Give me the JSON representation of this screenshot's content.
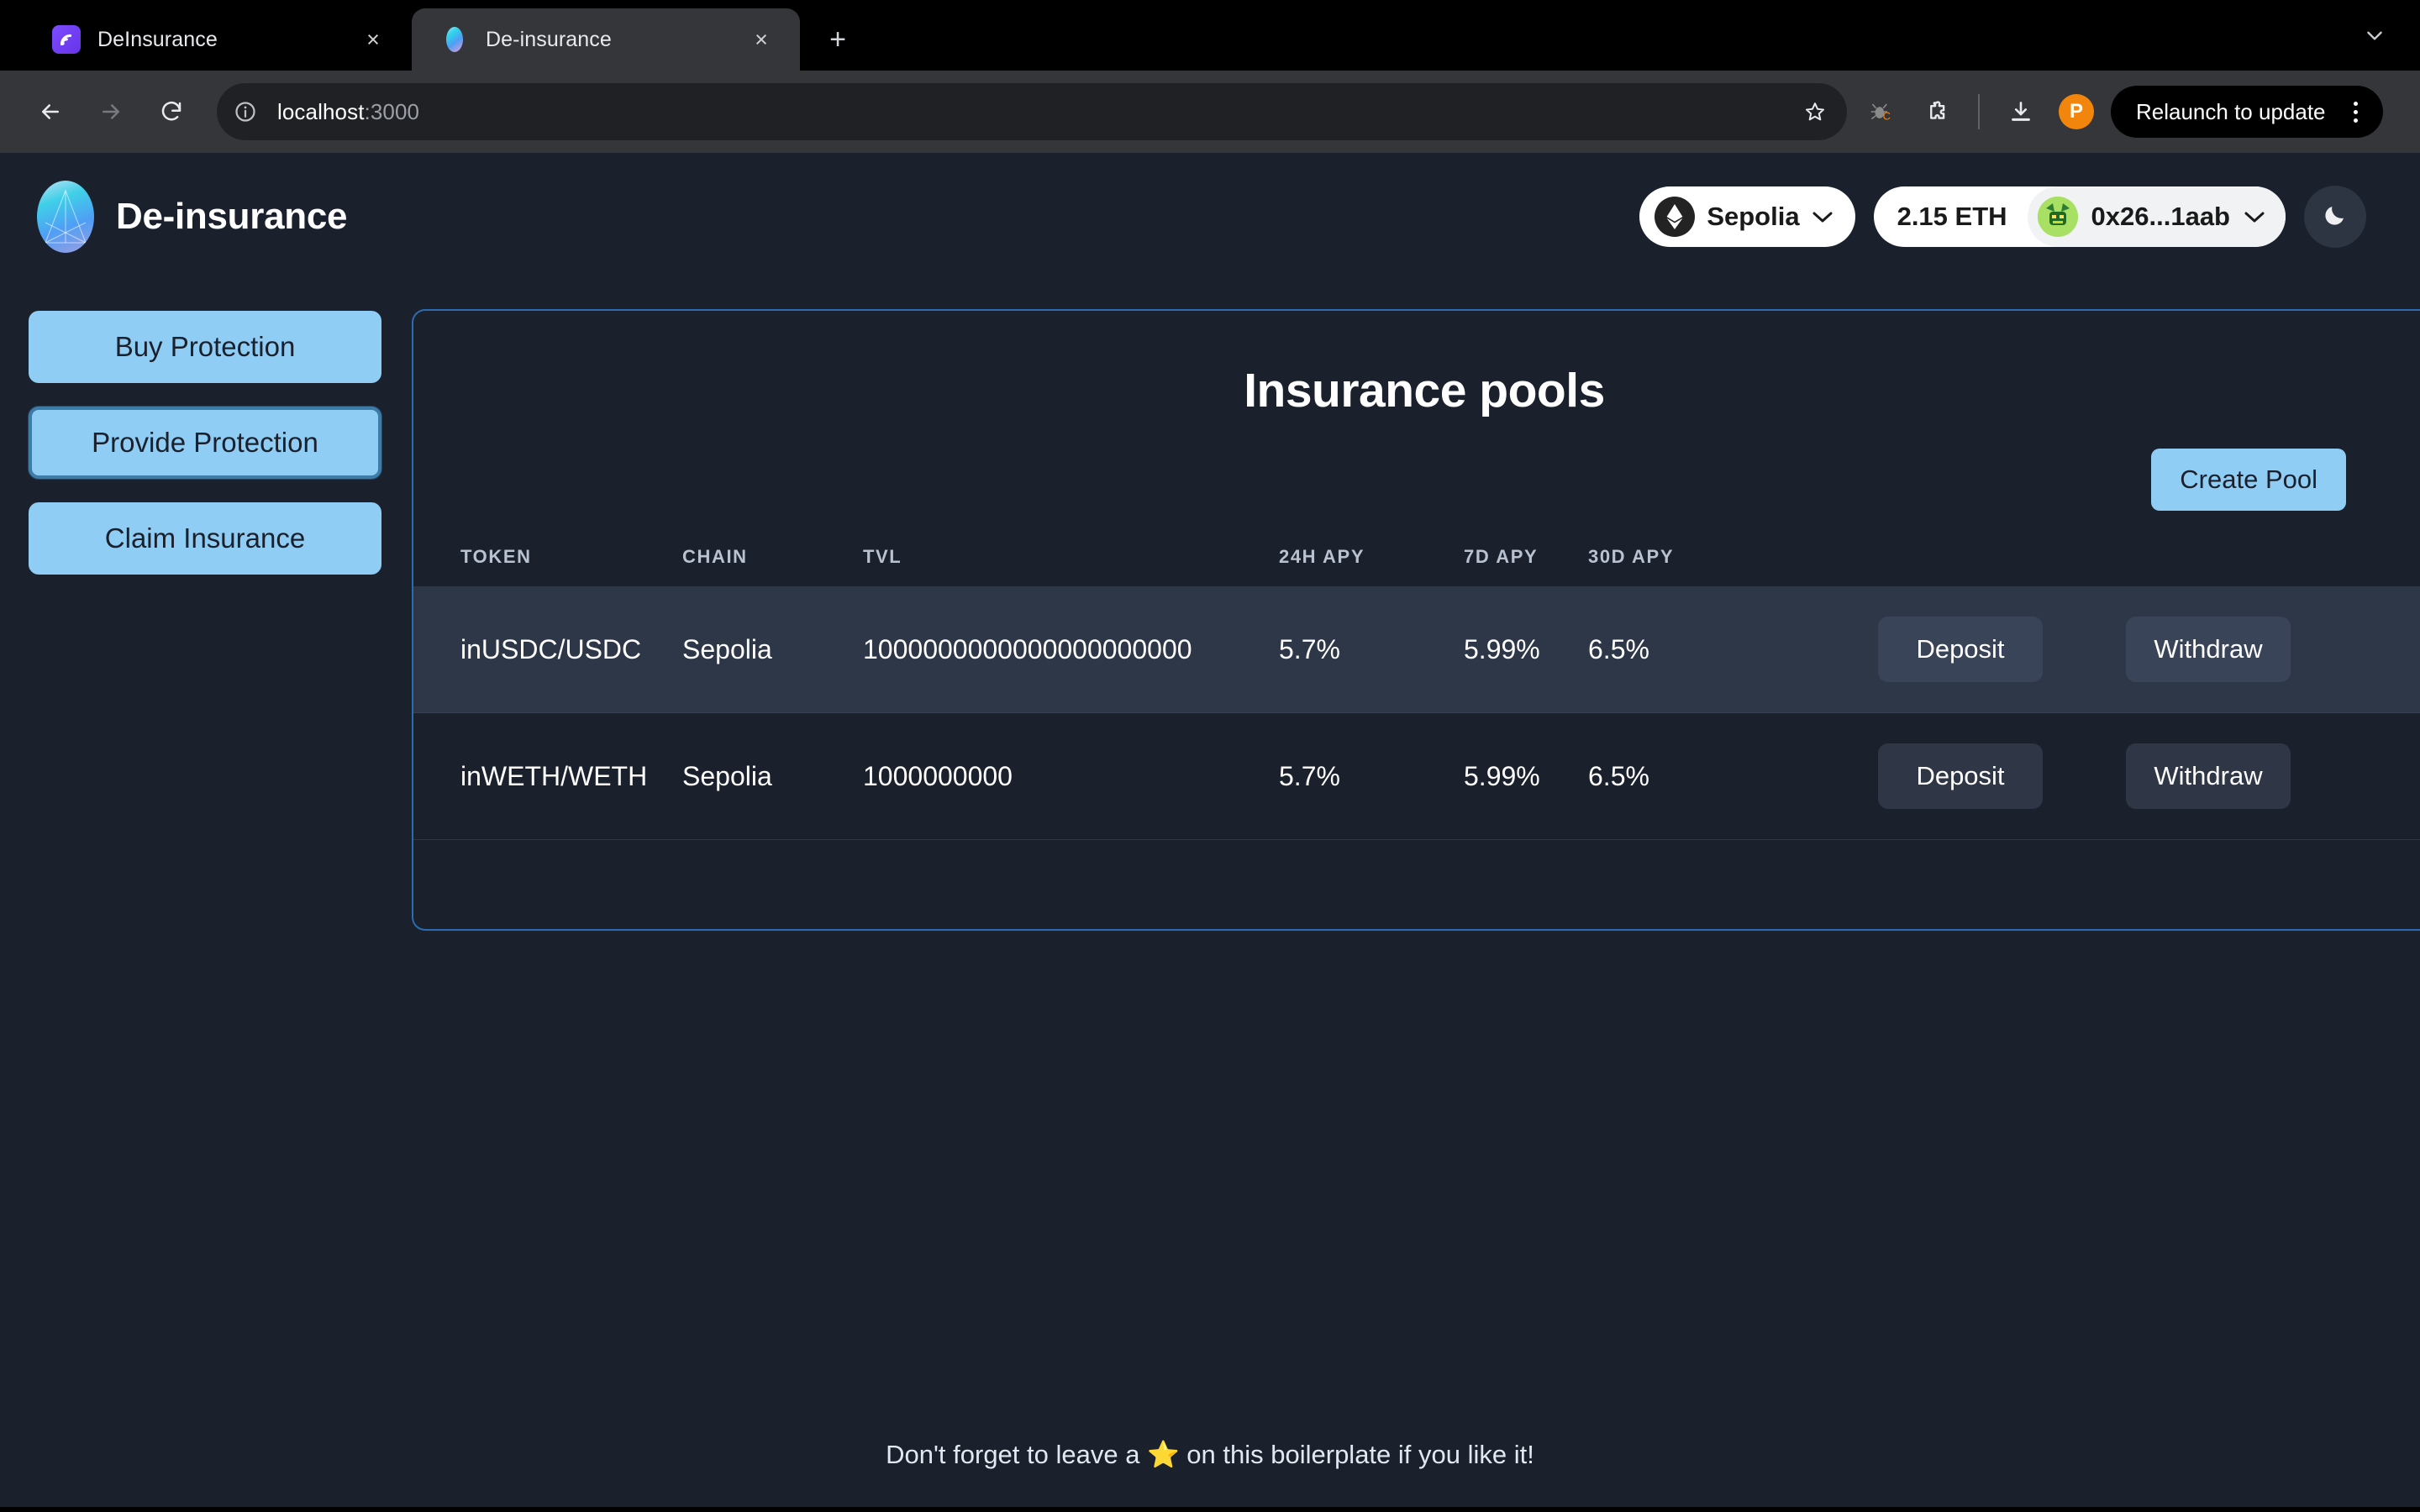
{
  "browser": {
    "tabs": [
      {
        "title": "DeInsurance",
        "favicon": "signal-wave-icon",
        "active": false
      },
      {
        "title": "De-insurance",
        "favicon": "de-insurance-logo-icon",
        "active": true
      }
    ],
    "new_tab_label": "+",
    "close_label": "×",
    "nav": {
      "back": "back-arrow-icon",
      "forward": "forward-arrow-icon",
      "reload": "reload-icon"
    },
    "omnibox": {
      "info_icon": "site-info-icon",
      "url_host": "localhost",
      "url_port": ":3000",
      "bookmark_icon": "star-icon"
    },
    "toolbar_icons": [
      "bug-c-icon",
      "extensions-puzzle-icon",
      "downloads-icon"
    ],
    "profile_initial": "P",
    "relaunch_label": "Relaunch to update",
    "menu_icon": "kebab-menu-icon",
    "tabstrip_menu_icon": "chevron-down-icon"
  },
  "app": {
    "brand": {
      "name": "De-insurance",
      "logo_icon": "pyramid-logo-icon"
    },
    "network": {
      "name": "Sepolia",
      "token_icon": "ethereum-icon",
      "chevron_icon": "chevron-down-icon"
    },
    "account": {
      "balance": "2.15 ETH",
      "address": "0x26...1aab",
      "avatar_icon": "jazzicon-avatar",
      "chevron_icon": "chevron-down-icon"
    },
    "theme_toggle": {
      "icon": "moon-icon"
    },
    "sidebar": {
      "items": [
        {
          "label": "Buy Protection",
          "active": false
        },
        {
          "label": "Provide Protection",
          "active": true
        },
        {
          "label": "Claim Insurance",
          "active": false
        }
      ]
    },
    "main": {
      "title": "Insurance pools",
      "create_pool_label": "Create Pool",
      "table": {
        "columns": [
          "TOKEN",
          "CHAIN",
          "TVL",
          "24H APY",
          "7D APY",
          "30D APY"
        ],
        "rows": [
          {
            "token": "inUSDC/USDC",
            "chain": "Sepolia",
            "tvl": "1000000000000000000000",
            "apy_24h": "5.7%",
            "apy_7d": "5.99%",
            "apy_30d": "6.5%",
            "deposit_label": "Deposit",
            "withdraw_label": "Withdraw"
          },
          {
            "token": "inWETH/WETH",
            "chain": "Sepolia",
            "tvl": "1000000000",
            "apy_24h": "5.7%",
            "apy_7d": "5.99%",
            "apy_30d": "6.5%",
            "deposit_label": "Deposit",
            "withdraw_label": "Withdraw"
          }
        ]
      }
    },
    "footer": {
      "text_before": "Don't forget to leave a ",
      "star": "⭐",
      "text_after": " on this boilerplate if you like it!"
    }
  },
  "colors": {
    "page_bg": "#1a202c",
    "accent_blue": "#90cdf4",
    "panel_border": "#2b6cb0",
    "row_alt": "#2d3748",
    "profile_orange": "#f2860d"
  }
}
